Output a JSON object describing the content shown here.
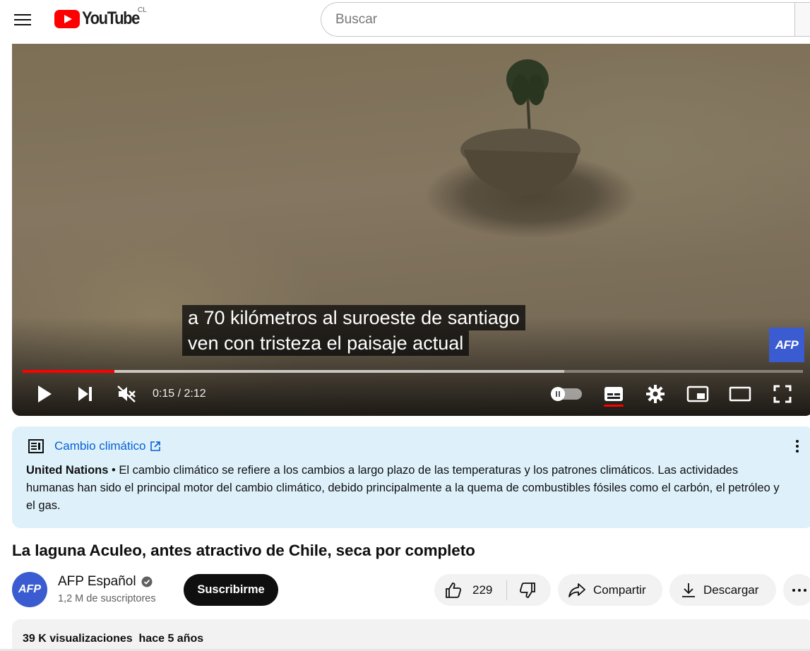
{
  "masthead": {
    "logo_text": "YouTube",
    "country_code": "CL",
    "search_placeholder": "Buscar"
  },
  "player": {
    "captions": [
      "a 70 kilómetros al suroeste de santiago",
      "ven con tristeza el paisaje actual"
    ],
    "watermark": "AFP",
    "time": "0:15 / 2:12",
    "progress_played_fraction": 0.118,
    "progress_buffered_fraction": 0.694,
    "muted": true,
    "captions_on": true
  },
  "info_panel": {
    "topic": "Cambio climático",
    "source": "United Nations",
    "separator": " • ",
    "text": "El cambio climático se refiere a los cambios a largo plazo de las temperaturas y los patrones climáticos. Las actividades humanas han sido el principal motor del cambio climático, debido principalmente a la quema de combustibles fósiles como el carbón, el petróleo y el gas."
  },
  "video": {
    "title": "La laguna Aculeo, antes atractivo de Chile, seca por completo"
  },
  "channel": {
    "avatar_text": "AFP",
    "name": "AFP Español",
    "subscribers": "1,2 M de suscriptores",
    "subscribe_label": "Suscribirme"
  },
  "actions": {
    "like_count": "229",
    "share_label": "Compartir",
    "download_label": "Descargar"
  },
  "description": {
    "views": "39 K visualizaciones",
    "age": "hace 5 años"
  },
  "colors": {
    "brand_red": "#ff0000",
    "afp_blue": "#3b5bd0",
    "link_blue": "#065fd4",
    "info_bg": "#def1fb"
  }
}
